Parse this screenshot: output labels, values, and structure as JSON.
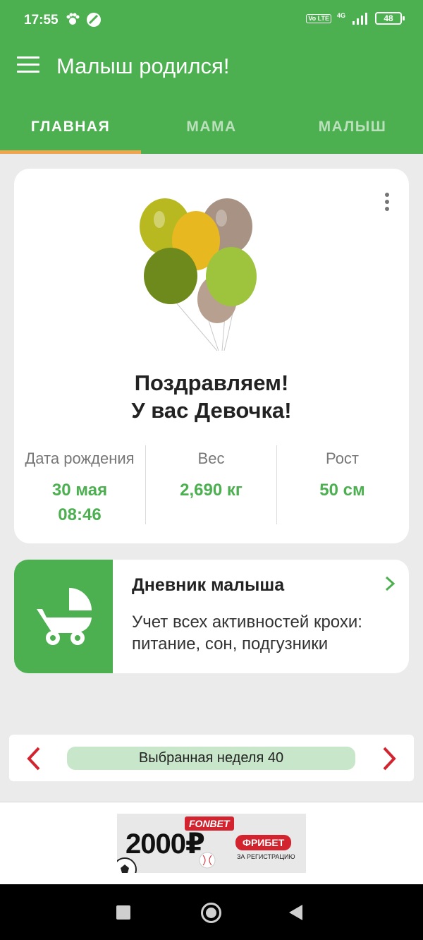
{
  "status_bar": {
    "time": "17:55",
    "network": "4G",
    "volte": "Vo LTE",
    "battery": "48"
  },
  "app_bar": {
    "title": "Малыш родился!"
  },
  "tabs": [
    {
      "label": "ГЛАВНАЯ",
      "active": true
    },
    {
      "label": "МАМА",
      "active": false
    },
    {
      "label": "МАЛЫШ",
      "active": false
    }
  ],
  "birth_card": {
    "congrats_line1": "Поздравляем!",
    "congrats_line2": "У вас Девочка!",
    "stats": [
      {
        "label": "Дата рождения",
        "value_line1": "30 мая",
        "value_line2": "08:46"
      },
      {
        "label": "Вес",
        "value_line1": "2,690 кг",
        "value_line2": ""
      },
      {
        "label": "Рост",
        "value_line1": "50 см",
        "value_line2": ""
      }
    ]
  },
  "diary": {
    "title": "Дневник малыша",
    "description": "Учет всех активностей крохи: питание, сон, подгузники"
  },
  "week_selector": {
    "label": "Выбранная неделя 40"
  },
  "ad": {
    "brand": "FONBET",
    "amount": "2000₽",
    "badge": "ФРИБЕТ",
    "subtitle": "ЗА РЕГИСТРАЦИЮ"
  },
  "colors": {
    "primary": "#4caf50",
    "tab_indicator": "#f2a44c",
    "arrow_red": "#d3232f",
    "week_pill": "#c8e6c9"
  },
  "icons": [
    "menu-icon",
    "more-vert-icon",
    "balloons-image",
    "stroller-icon",
    "chevron-right-icon",
    "chevron-left-icon",
    "nav-recents-icon",
    "nav-home-icon",
    "nav-back-icon"
  ]
}
